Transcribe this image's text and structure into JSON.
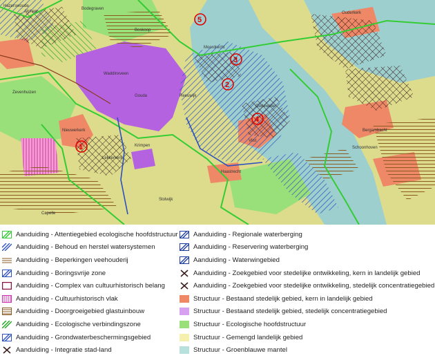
{
  "map": {
    "markers": [
      "1",
      "2",
      "3",
      "4",
      "5"
    ],
    "place_labels": [
      "Hazerswoude",
      "Alphen",
      "Bodegraven",
      "Boskoop",
      "Waddinxveen",
      "Gouda",
      "Reeuwijk",
      "Moordrecht",
      "Zevenhuizen",
      "Nieuwerkerk",
      "Krimpen",
      "Lekkerkerk",
      "Stolwijk",
      "Haastrecht",
      "Oudewater",
      "Vlist",
      "Schoonhoven",
      "Bergambacht",
      "Ouderkerk",
      "Capelle"
    ]
  },
  "legend": {
    "columns": [
      [
        {
          "label": "Aanduiding - Attentiegebied ecologische hoofdstructuur",
          "swatch": "hatch-green-outline"
        },
        {
          "label": "Aanduiding - Behoud en herstel watersystemen",
          "swatch": "hatch-blue"
        },
        {
          "label": "Aanduiding - Beperkingen veehouderij",
          "swatch": "hatch-brown-horizontal"
        },
        {
          "label": "Aanduiding - Boringsvrije zone",
          "swatch": "hatch-blue-dense"
        },
        {
          "label": "Aanduiding - Complex van cultuurhistorisch belang",
          "swatch": "outline-maroon"
        },
        {
          "label": "Aanduiding - Cultuurhistorisch vlak",
          "swatch": "vertical-magenta"
        },
        {
          "label": "Aanduiding - Doorgroeigebied glastuinbouw",
          "swatch": "hatch-brown-outline"
        },
        {
          "label": "Aanduiding - Ecologische verbindingszone",
          "swatch": "hatch-green"
        },
        {
          "label": "Aanduiding - Grondwaterbeschermingsgebied",
          "swatch": "hatch-blue-outline"
        },
        {
          "label": "Aanduiding - Integratie stad-land",
          "swatch": "cross-dark"
        }
      ],
      [
        {
          "label": "Aanduiding - Regionale waterberging",
          "swatch": "hatch-navy-outline"
        },
        {
          "label": "Aanduiding - Reservering waterberging",
          "swatch": "hatch-navy-outline"
        },
        {
          "label": "Aanduiding - Waterwingebied",
          "swatch": "hatch-navy-outline"
        },
        {
          "label": "Aanduiding - Zoekgebied voor stedelijke ontwikkeling, kern in landelijk gebied",
          "swatch": "cross-dark"
        },
        {
          "label": "Aanduiding - Zoekgebied voor stedelijke ontwikkeling, stedelijk concentratiegebied",
          "swatch": "cross-dark"
        },
        {
          "label": "Structuur - Bestaand stedelijk gebied, kern in landelijk gebied",
          "swatch": "fill-salmon"
        },
        {
          "label": "Structuur - Bestaand stedelijk gebied, stedelijk concentratiegebied",
          "swatch": "fill-lilac"
        },
        {
          "label": "Structuur - Ecologische hoofdstructuur",
          "swatch": "fill-green"
        },
        {
          "label": "Structuur - Gemengd landelijk gebied",
          "swatch": "fill-cream"
        },
        {
          "label": "Structuur - Groenblauwe mantel",
          "swatch": "fill-teal"
        }
      ]
    ]
  },
  "colors": {
    "rural": "#dcdc8c",
    "water": "#9ecfcf",
    "urban_core": "#ee8866",
    "urban_concentration": "#b462e0",
    "ecology": "#99e07a",
    "pink_area": "#f5a0d0",
    "boundary_green": "#33cc33",
    "hatch_blue": "#2a4fc0",
    "hatch_dark": "#3a1d1d",
    "hatch_brown": "#8a5a20",
    "marker_red": "#e00000"
  }
}
